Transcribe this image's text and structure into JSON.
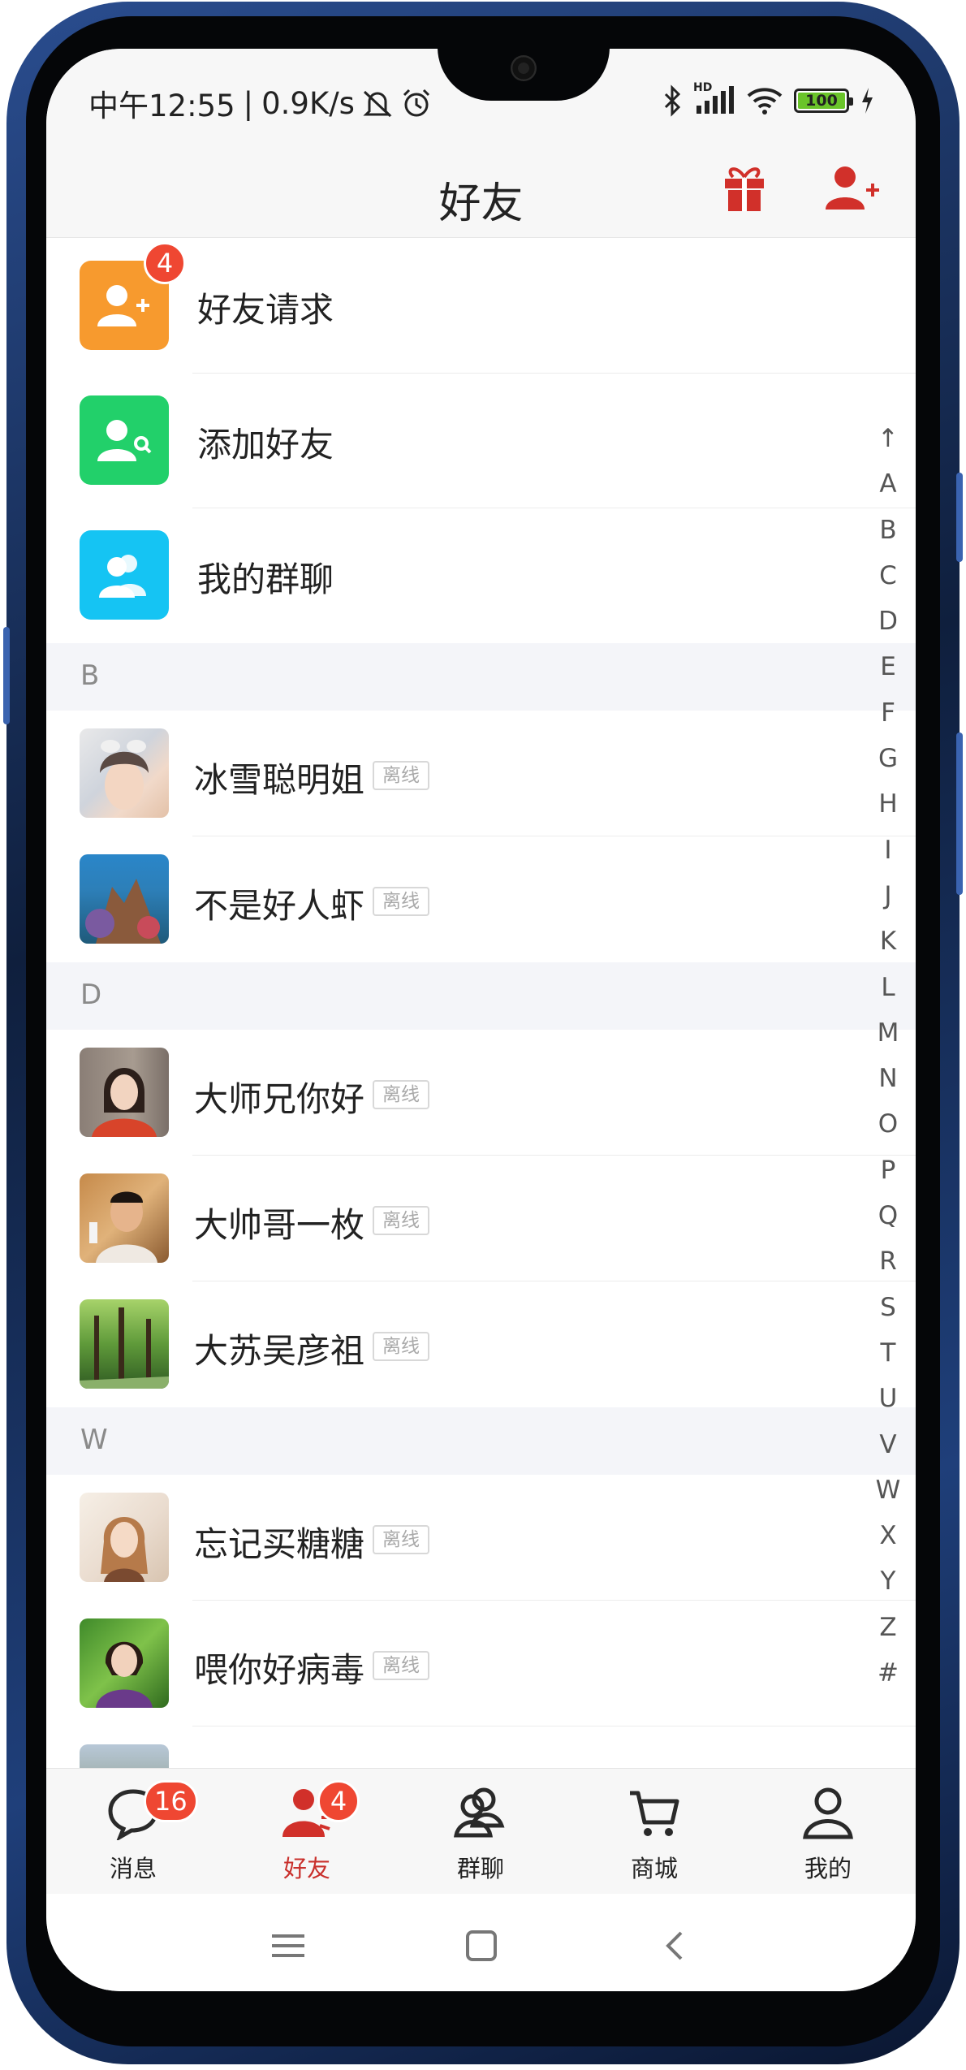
{
  "status_bar": {
    "time": "中午12:55",
    "separator": "|",
    "net_speed": "0.9K/s",
    "battery_level": "100",
    "network_tag": "HD"
  },
  "header": {
    "title": "好友",
    "gift_icon": "gift-icon",
    "add_friend_icon": "add-friend-icon",
    "accent_color": "#d1302a"
  },
  "features": [
    {
      "label": "好友请求",
      "icon": "user-plus-icon",
      "color": "#f79a2e",
      "badge": "4"
    },
    {
      "label": "添加好友",
      "icon": "user-search-icon",
      "color": "#22d06a"
    },
    {
      "label": "我的群聊",
      "icon": "group-icon",
      "color": "#15c4f3"
    }
  ],
  "sections": [
    {
      "letter": "B",
      "friends": [
        {
          "name": "冰雪聪明姐",
          "status": "离线"
        },
        {
          "name": "不是好人虾",
          "status": "离线"
        }
      ]
    },
    {
      "letter": "D",
      "friends": [
        {
          "name": "大师兄你好",
          "status": "离线"
        },
        {
          "name": "大帅哥一枚",
          "status": "离线"
        },
        {
          "name": "大苏吴彦祖",
          "status": "离线"
        }
      ]
    },
    {
      "letter": "W",
      "friends": [
        {
          "name": "忘记买糖糖",
          "status": "离线"
        },
        {
          "name": "喂你好病毒",
          "status": "离线"
        }
      ]
    }
  ],
  "alphabet_index": [
    "↑",
    "A",
    "B",
    "C",
    "D",
    "E",
    "F",
    "G",
    "H",
    "I",
    "J",
    "K",
    "L",
    "M",
    "N",
    "O",
    "P",
    "Q",
    "R",
    "S",
    "T",
    "U",
    "V",
    "W",
    "X",
    "Y",
    "Z",
    "#"
  ],
  "tabs": [
    {
      "label": "消息",
      "icon": "chat-bubble-icon",
      "badge": "16",
      "active": false
    },
    {
      "label": "好友",
      "icon": "friends-icon",
      "badge": "4",
      "active": true
    },
    {
      "label": "群聊",
      "icon": "group-chat-icon",
      "active": false
    },
    {
      "label": "商城",
      "icon": "cart-icon",
      "active": false
    },
    {
      "label": "我的",
      "icon": "profile-icon",
      "active": false
    }
  ],
  "nav_bar": {
    "recents_icon": "menu-icon",
    "home_icon": "home-square-icon",
    "back_icon": "back-chevron-icon"
  }
}
